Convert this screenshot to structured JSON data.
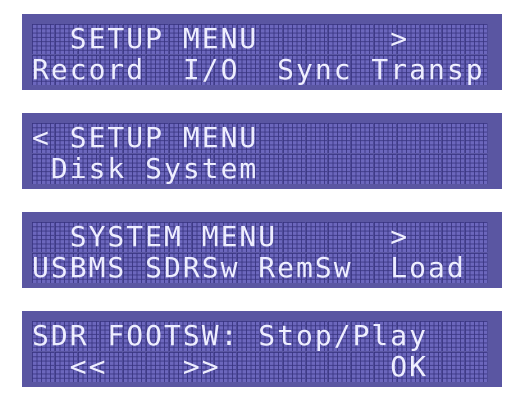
{
  "screens": [
    {
      "name": "setup-menu-1",
      "row1": "  SETUP MENU       >",
      "row2": "Record  I/O  Sync Transp"
    },
    {
      "name": "setup-menu-2",
      "row1": "< SETUP MENU",
      "row2": " Disk System"
    },
    {
      "name": "system-menu",
      "row1": "  SYSTEM MENU      >",
      "row2": "USBMS SDRSw RemSw  Load"
    },
    {
      "name": "sdr-footsw",
      "row1": "SDR FOOTSW: Stop/Play",
      "row2": "  <<    >>         OK"
    }
  ],
  "colors": {
    "lcd_bg": "#5a56a2",
    "cell": "#6c67bd",
    "text": "#eeeefe"
  }
}
